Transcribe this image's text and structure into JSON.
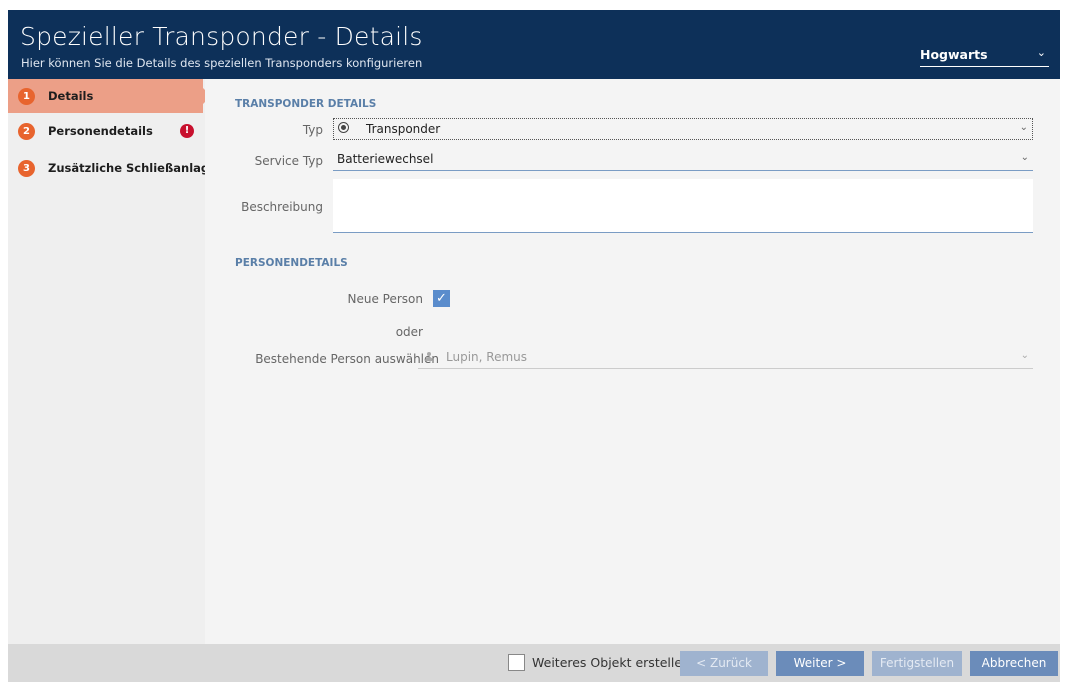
{
  "header": {
    "title": "Spezieller Transponder - Details",
    "subtitle": "Hier können Sie die Details des speziellen Transponders konfigurieren",
    "site": "Hogwarts"
  },
  "sidebar": {
    "steps": [
      {
        "num": "1",
        "label": "Details"
      },
      {
        "num": "2",
        "label": "Personendetails"
      },
      {
        "num": "3",
        "label": "Zusätzliche Schließanlagen"
      }
    ],
    "alert": "!"
  },
  "transponder": {
    "section": "TRANSPONDER DETAILS",
    "typ_label": "Typ",
    "typ_value": "Transponder",
    "service_label": "Service Typ",
    "service_value": "Batteriewechsel",
    "desc_label": "Beschreibung"
  },
  "person": {
    "section": "PERSONENDETAILS",
    "new_label": "Neue Person",
    "or_label": "oder",
    "existing_label": "Bestehende Person auswählen",
    "existing_value": "Lupin, Remus"
  },
  "footer": {
    "more_label": "Weiteres Objekt erstellen",
    "back": "< Zurück",
    "next": "Weiter >",
    "finish": "Fertigstellen",
    "cancel": "Abbrechen"
  },
  "icons": {
    "chevron": "⌄",
    "check": "✓"
  }
}
